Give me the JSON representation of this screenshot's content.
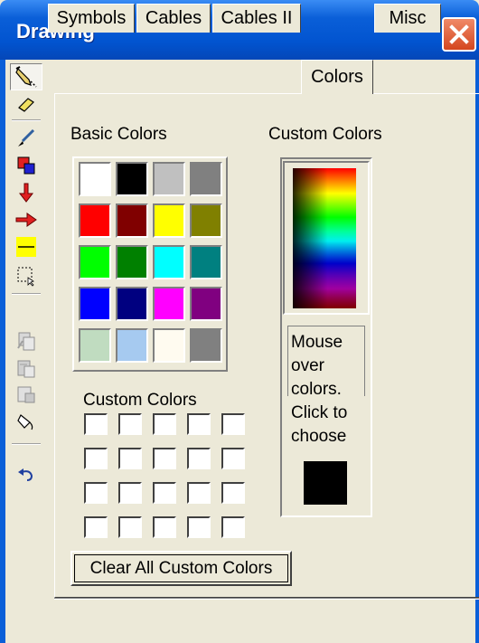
{
  "window": {
    "title": "Drawing"
  },
  "toolbar": {
    "buttons": [
      {
        "icon": "pencil-select-icon",
        "pressed": true
      },
      {
        "icon": "eraser-icon"
      },
      {
        "icon": "pen-icon"
      },
      {
        "icon": "color-swap-icon"
      },
      {
        "icon": "arrow-down-icon"
      },
      {
        "icon": "arrow-right-icon"
      },
      {
        "icon": "line-icon"
      },
      {
        "icon": "marquee-select-icon"
      },
      {
        "icon": "copy-drawing-icon"
      },
      {
        "icon": "paste-drawing-icon"
      },
      {
        "icon": "page-layout-icon"
      },
      {
        "icon": "fill-icon"
      },
      {
        "icon": "undo-icon"
      }
    ]
  },
  "tabs": [
    {
      "label": "Symbols",
      "active": false
    },
    {
      "label": "Cables",
      "active": false
    },
    {
      "label": "Cables II",
      "active": false
    },
    {
      "label": "Colors",
      "active": true
    },
    {
      "label": "Misc",
      "active": false
    }
  ],
  "colors_tab": {
    "basic_colors_label": "Basic Colors",
    "custom_colors_label_right": "Custom Colors",
    "custom_colors_label_left": "Custom Colors",
    "basic_colors": [
      "#ffffff",
      "#000000",
      "#c0c0c0",
      "#808080",
      "#ff0000",
      "#800000",
      "#ffff00",
      "#808000",
      "#00ff00",
      "#008000",
      "#00ffff",
      "#008080",
      "#0000ff",
      "#000080",
      "#ff00ff",
      "#800080",
      "#c0dcc0",
      "#a6caf0",
      "#fffbf0",
      "#808080"
    ],
    "custom_slots": 20,
    "hint_lines": [
      "Mouse",
      "over",
      "colors.",
      "Click to",
      "choose"
    ],
    "current_color": "#000000",
    "clear_button_label": "Clear All Custom Colors"
  }
}
